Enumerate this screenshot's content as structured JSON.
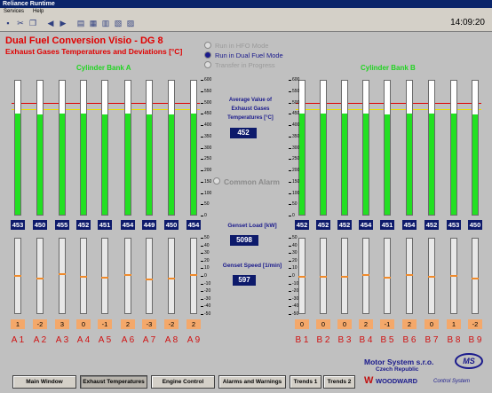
{
  "window": {
    "title": "Reliance Runtime",
    "clock": "14:09:20"
  },
  "menu": [
    "Services",
    "Help"
  ],
  "toolbar": [
    "save-icon",
    "cut-icon",
    "copy-icon",
    "back-icon",
    "forward-icon",
    "print-icon",
    "document-icon",
    "document-icon",
    "document-icon",
    "document-icon"
  ],
  "header": {
    "title": "Dual Fuel Conversion Visio - DG 8",
    "subtitle": "Exhaust Gases Temperatures and Deviations [°C]"
  },
  "modes": [
    {
      "label": "Run in HFO Mode",
      "active": false
    },
    {
      "label": "Run in Dual Fuel Mode",
      "active": true
    },
    {
      "label": "Transfer in Progress",
      "active": false
    }
  ],
  "bank_a": {
    "title": "Cylinder Bank A",
    "labels": [
      "A 1",
      "A 2",
      "A 3",
      "A 4",
      "A 5",
      "A 6",
      "A 7",
      "A 8",
      "A 9"
    ],
    "temps": [
      453,
      450,
      455,
      452,
      451,
      454,
      449,
      450,
      454
    ],
    "deviations": [
      1,
      -2,
      3,
      0,
      -1,
      2,
      -3,
      -2,
      2
    ]
  },
  "bank_b": {
    "title": "Cylinder Bank B",
    "labels": [
      "B 1",
      "B 2",
      "B 3",
      "B 4",
      "B 5",
      "B 6",
      "B 7",
      "B 8",
      "B 9"
    ],
    "temps": [
      452,
      452,
      452,
      454,
      451,
      454,
      452,
      453,
      450
    ],
    "deviations": [
      0,
      0,
      0,
      2,
      -1,
      2,
      0,
      1,
      -2
    ]
  },
  "temp_scale": [
    "600",
    "550",
    "500",
    "450",
    "400",
    "350",
    "300",
    "250",
    "200",
    "150",
    "100",
    "50",
    "0"
  ],
  "dev_scale": [
    "50",
    "40",
    "30",
    "20",
    "10",
    "0",
    "-10",
    "-20",
    "-30",
    "-40",
    "-50"
  ],
  "limits": {
    "red": 500,
    "yellow": 470,
    "temp_max": 600,
    "dev_max": 50
  },
  "center": {
    "avg_label": "Average Value of Exhaust Gases Temperatures [°C]",
    "avg_value": "452",
    "common_alarm": "Common Alarm",
    "load_label": "Genset Load [kW]",
    "load_value": "5098",
    "speed_label": "Genset Speed [1/min]",
    "speed_value": "597"
  },
  "company": {
    "name": "Motor System s.r.o.",
    "country": "Czech Republic",
    "brand": "WOODWARD",
    "brand_sub": "Control System",
    "logo_text": "MS"
  },
  "nav": [
    {
      "label": "Main Window",
      "active": false
    },
    {
      "label": "Exhaust Temperatures",
      "active": true
    },
    {
      "label": "Engine Control",
      "active": false
    },
    {
      "label": "Alarms and Warnings",
      "active": false
    },
    {
      "label": "Trends 1",
      "active": false
    },
    {
      "label": "Trends 2",
      "active": false
    }
  ],
  "colors": {
    "fill": "#22e022",
    "red_limit": "#e00000",
    "yellow_limit": "#e8e000",
    "value_box": "#0d1a6b",
    "deviation_box": "#f4a86a",
    "deviation_mark": "#f08a2a",
    "accent": "#e00000"
  }
}
